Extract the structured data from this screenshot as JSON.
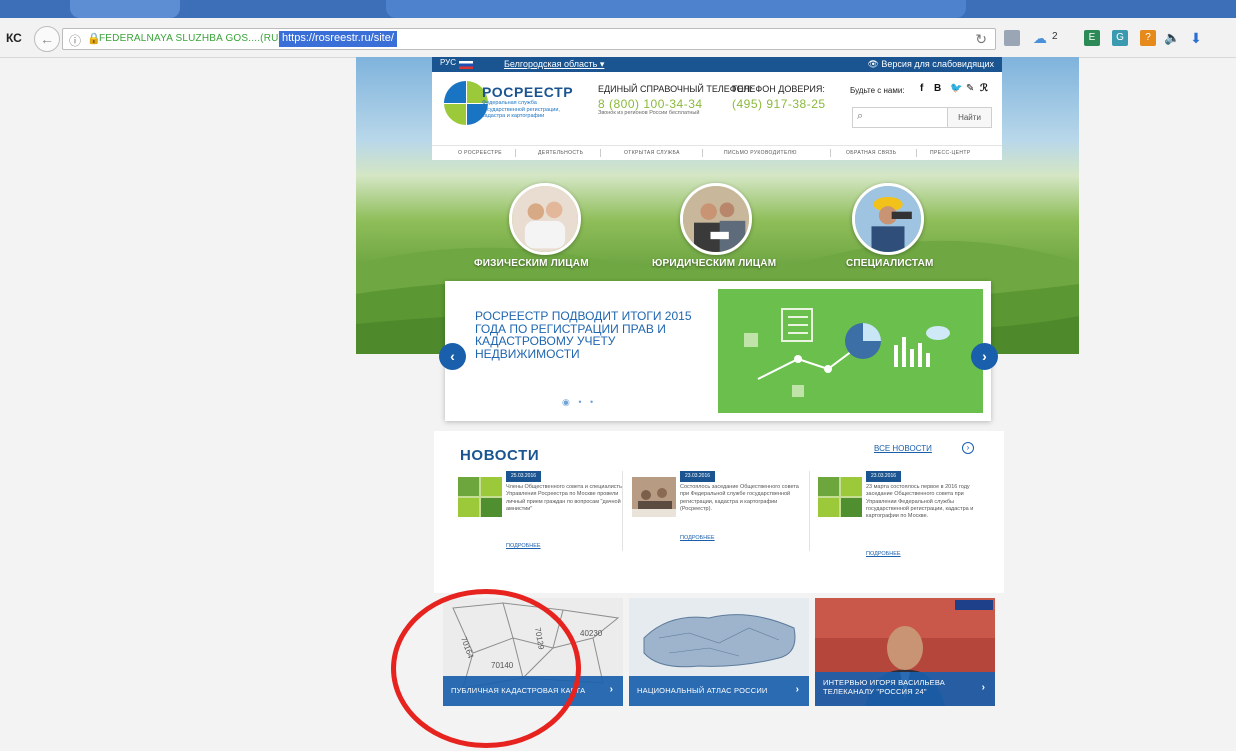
{
  "browser": {
    "left_label": "КС",
    "site_identity": "FEDERALNAYA SLUZHBA GOS....(RU)",
    "url": "https://rosreestr.ru/site/",
    "notifications": "2"
  },
  "topstrip": {
    "lang": "РУС",
    "region": "Белгородская область ▾",
    "low_vision": "Версия для слабовидящих"
  },
  "header": {
    "brand": "РОСРЕЕСТР",
    "brand_sub": "Федеральная служба государственной регистрации, кадастра и картографии",
    "phone_label": "ЕДИНЫЙ СПРАВОЧНЫЙ ТЕЛЕФОН:",
    "phone": "8 (800) 100-34-34",
    "phone_note": "Звонок из регионов России бесплатный",
    "trust_label": "ТЕЛЕФОН ДОВЕРИЯ:",
    "trust_phone": "(495) 917-38-25",
    "follow": "Будьте с нами:",
    "search_button": "Найти"
  },
  "nav": [
    "О РОСРЕЕСТРЕ",
    "ДЕЯТЕЛЬНОСТЬ",
    "ОТКРЫТАЯ СЛУЖБА",
    "ПИСЬМО РУКОВОДИТЕЛЮ",
    "ОБРАТНАЯ СВЯЗЬ",
    "ПРЕСС-ЦЕНТР"
  ],
  "categories": [
    "ФИЗИЧЕСКИМ ЛИЦАМ",
    "ЮРИДИЧЕСКИМ ЛИЦАМ",
    "СПЕЦИАЛИСТАМ"
  ],
  "slider": {
    "title": "РОСРЕЕСТР ПОДВОДИТ ИТОГИ 2015 ГОДА ПО РЕГИСТРАЦИИ ПРАВ И КАДАСТРОВОМУ УЧЕТУ НЕДВИЖИМОСТИ",
    "dots": "◉ • •"
  },
  "news": {
    "title": "НОВОСТИ",
    "all": "ВСЕ НОВОСТИ",
    "more": "ПОДРОБНЕЕ",
    "items": [
      {
        "date": "25.03.2016",
        "text": "Члены Общественного совета и специалисты Управления Росреестра по Москве провели личный прием граждан по вопросам \"дачной амнистии\""
      },
      {
        "date": "23.03.2016",
        "text": "Состоялось заседание Общественного совета при Федеральной службе государственной регистрации, кадастра и картографии (Росреестр)."
      },
      {
        "date": "23.03.2016",
        "text": "23 марта состоялось первое в 2016 году заседание Общественного совета при Управлении Федеральной службы государственной регистрации, кадастра и картографии по Москве."
      }
    ]
  },
  "tiles": [
    {
      "label": "ПУБЛИЧНАЯ КАДАСТРОВАЯ КАРТА"
    },
    {
      "label": "НАЦИОНАЛЬНЫЙ АТЛАС РОССИИ"
    },
    {
      "label": "ИНТЕРВЬЮ ИГОРЯ ВАСИЛЬЕВА ТЕЛЕКАНАЛУ \"РОССИЯ 24\""
    }
  ],
  "map_labels": [
    "70164",
    "70140",
    "40230",
    "70129"
  ]
}
